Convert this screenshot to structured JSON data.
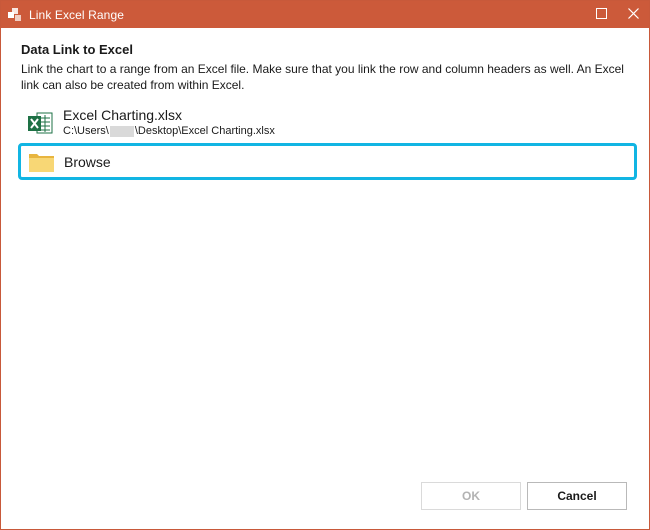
{
  "window": {
    "title": "Link Excel Range",
    "title_bar_color": "#cc5a3a",
    "controls": {
      "maximize_icon": "maximize-icon",
      "close_icon": "close-icon"
    }
  },
  "main": {
    "heading": "Data Link to Excel",
    "description": "Link the chart to a range from an Excel file. Make sure that you link the row and column headers as well. An Excel link can also be created from within Excel."
  },
  "files": [
    {
      "icon": "excel-file-icon",
      "name": "Excel Charting.xlsx",
      "path_prefix": "C:\\Users\\",
      "path_suffix": "\\Desktop\\Excel Charting.xlsx"
    }
  ],
  "browse": {
    "icon": "folder-icon",
    "label": "Browse",
    "highlight_color": "#11b5e3"
  },
  "footer": {
    "ok_label": "OK",
    "cancel_label": "Cancel"
  }
}
